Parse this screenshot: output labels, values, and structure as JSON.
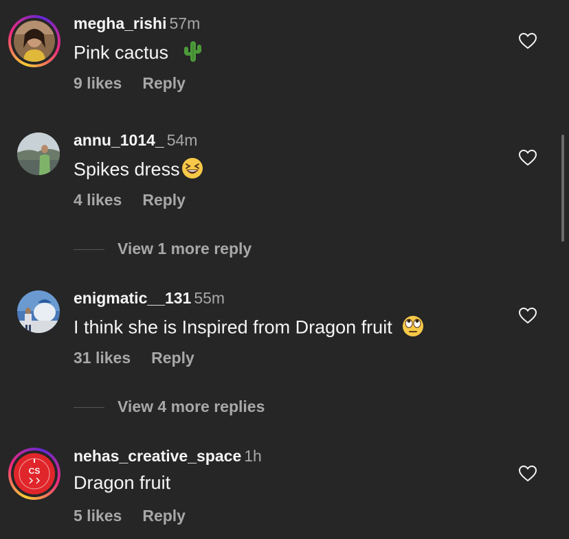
{
  "comments": [
    {
      "username": "megha_rishi",
      "time": "57m",
      "text": "Pink cactus",
      "emoji": "cactus-icon",
      "likes": "9 likes",
      "reply": "Reply"
    },
    {
      "username": "annu_1014_",
      "time": "54m",
      "text": "Spikes dress",
      "emoji": "laughing-face-icon",
      "likes": "4 likes",
      "reply": "Reply",
      "view_more": "View 1 more reply"
    },
    {
      "username": "enigmatic__131",
      "time": "55m",
      "text": "I think she is Inspired from Dragon fruit",
      "emoji": "eye-roll-face-icon",
      "likes": "31 likes",
      "reply": "Reply",
      "view_more": "View 4 more replies"
    },
    {
      "username": "nehas_creative_space",
      "time": "1h",
      "text": "Dragon fruit",
      "likes": "5 likes",
      "reply": "Reply",
      "avatar_text": "CS"
    }
  ],
  "colors": {
    "background": "#262626",
    "primary_text": "#f5f5f5",
    "secondary_text": "#a8a8a8"
  }
}
